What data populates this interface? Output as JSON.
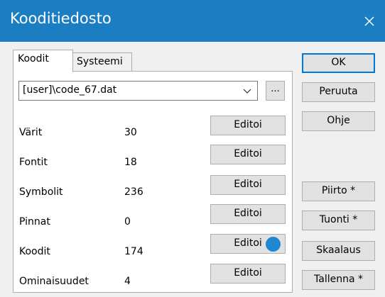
{
  "window": {
    "title": "Kooditiedosto",
    "titlebar_color": "#1b7ec2",
    "close_icon": "close-icon"
  },
  "tabs": [
    {
      "label": "Koodit",
      "active": true
    },
    {
      "label": "Systeemi",
      "active": false
    }
  ],
  "file": {
    "selected_value": "[user]\\code_67.dat",
    "browse_label": "..."
  },
  "rows": [
    {
      "label": "Värit",
      "count": "30",
      "button": "Editoi"
    },
    {
      "label": "Fontit",
      "count": "18",
      "button": "Editoi"
    },
    {
      "label": "Symbolit",
      "count": "236",
      "button": "Editoi"
    },
    {
      "label": "Pinnat",
      "count": "0",
      "button": "Editoi"
    },
    {
      "label": "Koodit",
      "count": "174",
      "button": "Editoi"
    },
    {
      "label": "Ominaisuudet",
      "count": "4",
      "button": "Editoi"
    }
  ],
  "side_buttons": {
    "ok": "OK",
    "cancel": "Peruuta",
    "help": "Ohje",
    "draw": "Piirto *",
    "import": "Tuonti *",
    "scale": "Skaalaus",
    "save": "Tallenna *"
  },
  "accent_color": "#1e88d4"
}
